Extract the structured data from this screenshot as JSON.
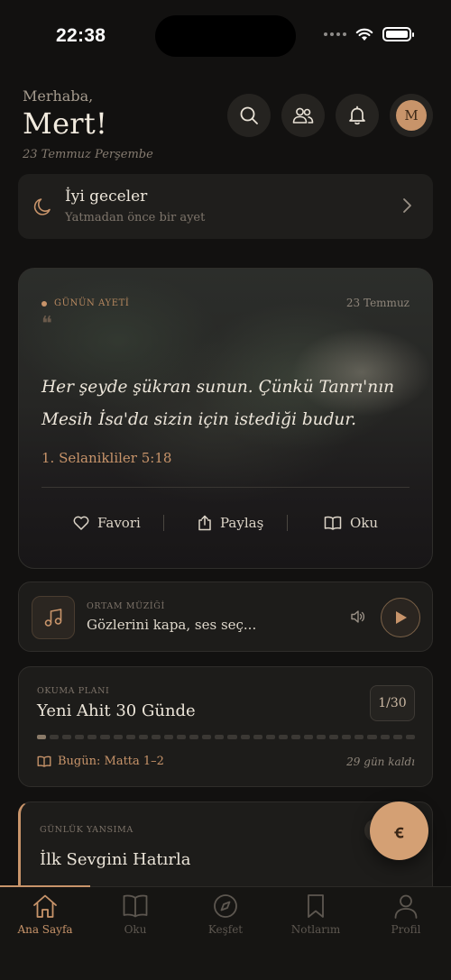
{
  "status_bar": {
    "time": "22:38"
  },
  "header": {
    "greeting": "Merhaba,",
    "name": "Mert!",
    "date": "23 Temmuz Perşembe",
    "actions": [
      "search-icon",
      "people-icon",
      "bell-icon"
    ],
    "avatar_initial": "M"
  },
  "night_card": {
    "title": "İyi geceler",
    "subtitle": "Yatmadan önce bir ayet"
  },
  "verse_card": {
    "label": "GÜNÜN AYETİ",
    "date": "23 Temmuz",
    "quote_mark": "❝",
    "text": "Her şeyde şükran sunun. Çünkü Tanrı'nın Mesih İsa'da sizin için istediği budur.",
    "reference": "1. Selanikliler 5:18",
    "actions": {
      "favorite": "Favori",
      "share": "Paylaş",
      "read": "Oku"
    }
  },
  "music_card": {
    "label": "ORTAM MÜZİĞİ",
    "title": "Gözlerini kapa, ses seç..."
  },
  "plan_card": {
    "label": "OKUMA PLANI",
    "title": "Yeni Ahit 30 Günde",
    "badge": "1/30",
    "progress": {
      "done": 1,
      "total": 30
    },
    "today": "Bugün: Matta 1–2",
    "remaining": "29 gün kaldı"
  },
  "reflection_card": {
    "label": "GÜNLÜK YANSIMA",
    "title": "İlk Sevgini Hatırla"
  },
  "fab": {
    "glyph": "ꞓ"
  },
  "tab_bar": {
    "items": [
      {
        "label": "Ana Sayfa",
        "icon": "home-icon",
        "active": true
      },
      {
        "label": "Oku",
        "icon": "book-icon",
        "active": false
      },
      {
        "label": "Keşfet",
        "icon": "compass-icon",
        "active": false
      },
      {
        "label": "Notlarım",
        "icon": "bookmark-icon",
        "active": false
      },
      {
        "label": "Profil",
        "icon": "profile-icon",
        "active": false
      }
    ]
  },
  "colors": {
    "background": "#121110",
    "accent": "#c8946a",
    "card": "#1d1c1a"
  }
}
